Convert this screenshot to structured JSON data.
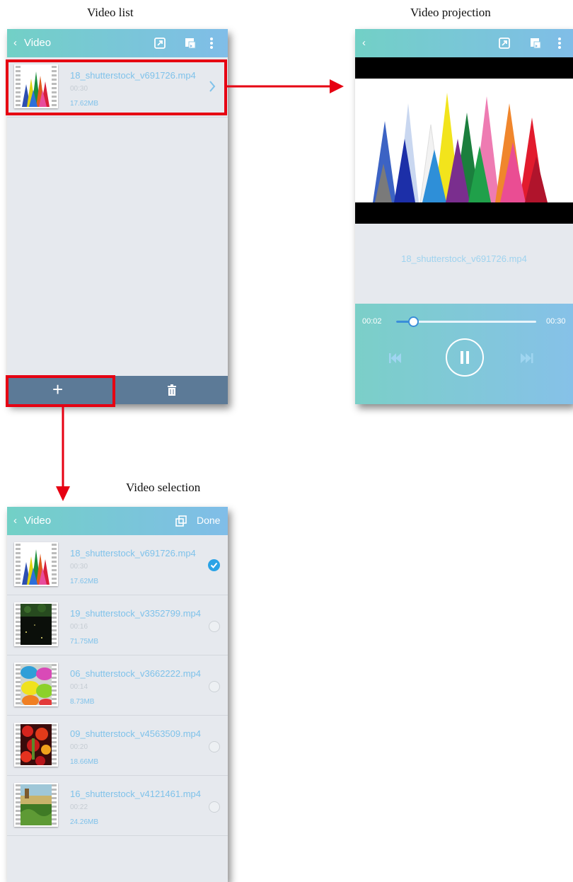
{
  "captions": {
    "list": "Video list",
    "projection": "Video projection",
    "selection": "Video selection"
  },
  "colors": {
    "accent": "#7fc2ea",
    "highlight": "#e60012",
    "toolbar": "#5c7a97",
    "check": "#2aa3e6"
  },
  "video_list": {
    "back_icon": "chevron-left-icon",
    "title": "Video",
    "toolbar_icons": [
      "cast-icon",
      "screen-mirror-icon",
      "more-vert-icon"
    ],
    "item": {
      "name": "18_shutterstock_v691726.mp4",
      "duration": "00:30",
      "size": "17.62MB"
    },
    "bottom_bar": {
      "add_label": "+",
      "delete_icon": "trash-icon"
    }
  },
  "projection": {
    "back_icon": "chevron-left-icon",
    "file_name": "18_shutterstock_v691726.mp4",
    "current_time": "00:02",
    "total_time": "00:30",
    "progress": 0.12
  },
  "selection": {
    "title": "Video",
    "select_all_icon": "copy-icon",
    "done_label": "Done",
    "items": [
      {
        "name": "18_shutterstock_v691726.mp4",
        "duration": "00:30",
        "size": "17.62MB",
        "selected": true
      },
      {
        "name": "19_shutterstock_v3352799.mp4",
        "duration": "00:16",
        "size": "71.75MB",
        "selected": false
      },
      {
        "name": "06_shutterstock_v3662222.mp4",
        "duration": "00:14",
        "size": "8.73MB",
        "selected": false
      },
      {
        "name": "09_shutterstock_v4563509.mp4",
        "duration": "00:20",
        "size": "18.66MB",
        "selected": false
      },
      {
        "name": "16_shutterstock_v4121461.mp4",
        "duration": "00:22",
        "size": "24.26MB",
        "selected": false
      }
    ]
  }
}
